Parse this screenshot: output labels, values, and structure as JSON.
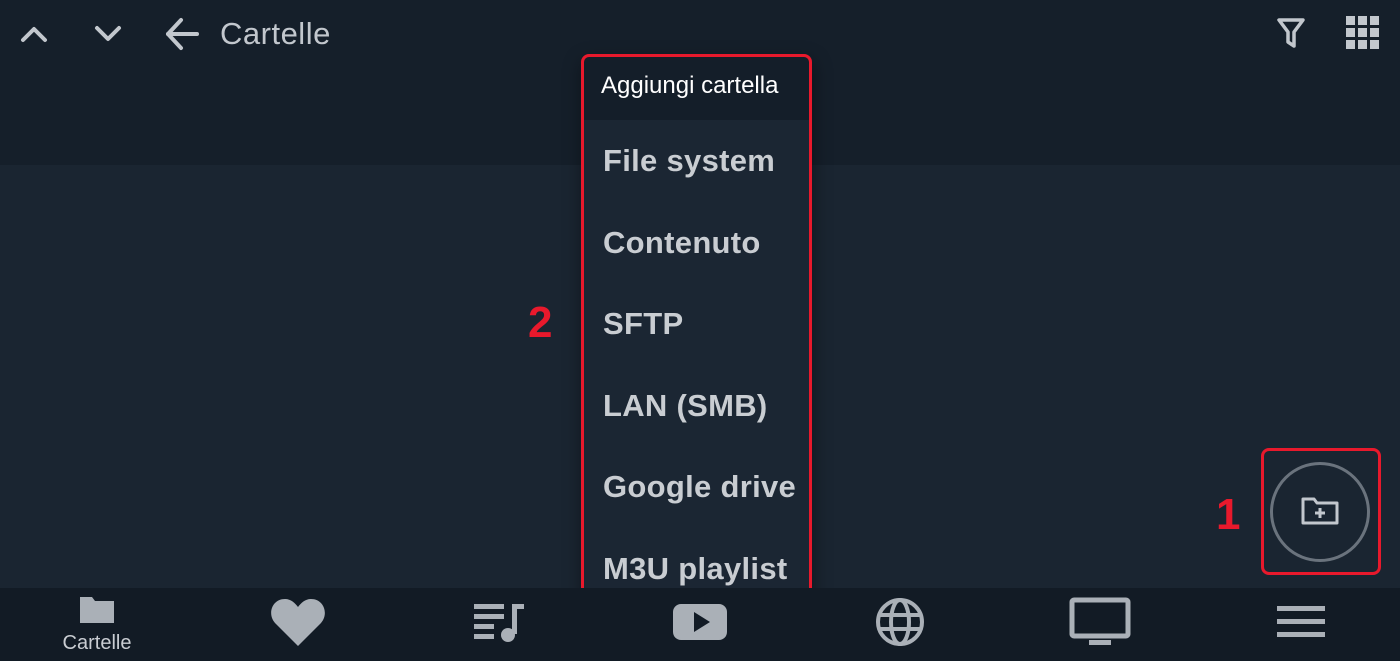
{
  "header": {
    "title": "Cartelle",
    "icons": [
      "chevron-up-icon",
      "chevron-down-icon",
      "back-arrow-icon",
      "filter-icon",
      "grid-icon"
    ]
  },
  "menu": {
    "header": "Aggiungi cartella",
    "items": [
      {
        "label": "File system"
      },
      {
        "label": "Contenuto"
      },
      {
        "label": "SFTP"
      },
      {
        "label": "LAN (SMB)"
      },
      {
        "label": "Google drive"
      },
      {
        "label": "M3U playlist"
      }
    ]
  },
  "annotations": {
    "marker_1": "1",
    "marker_2": "2",
    "highlight_color": "#e8192c"
  },
  "fab": {
    "icon": "folder-plus-icon"
  },
  "bottom_nav": {
    "items": [
      {
        "icon": "folder-icon",
        "label": "Cartelle"
      },
      {
        "icon": "heart-icon"
      },
      {
        "icon": "playlist-icon"
      },
      {
        "icon": "youtube-icon"
      },
      {
        "icon": "globe-icon"
      },
      {
        "icon": "tv-icon"
      },
      {
        "icon": "menu-icon"
      }
    ]
  }
}
